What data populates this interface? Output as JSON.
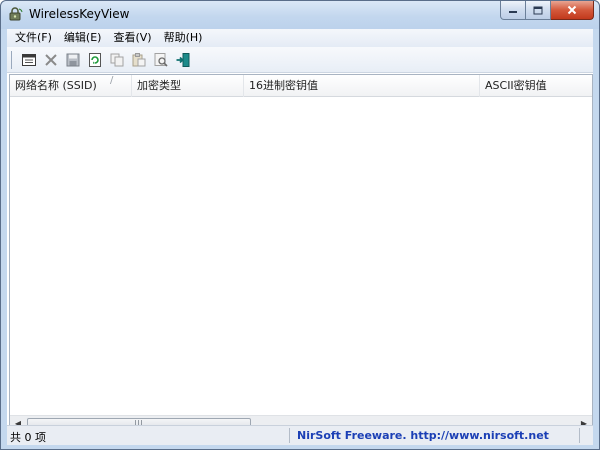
{
  "window": {
    "title": "WirelessKeyView",
    "colors": {
      "title_bg": "#c4d8ee",
      "close_btn": "#c2391c",
      "link_blue": "#1b3fb5"
    }
  },
  "menubar": {
    "items": [
      {
        "label": "文件(F)"
      },
      {
        "label": "编辑(E)"
      },
      {
        "label": "查看(V)"
      },
      {
        "label": "帮助(H)"
      }
    ]
  },
  "toolbar": {
    "buttons": [
      {
        "icon": "properties-icon"
      },
      {
        "icon": "delete-icon"
      },
      {
        "icon": "save-icon"
      },
      {
        "icon": "refresh-icon"
      },
      {
        "icon": "copy-icon"
      },
      {
        "icon": "paste-icon"
      },
      {
        "icon": "find-icon"
      },
      {
        "icon": "exit-icon"
      }
    ]
  },
  "list": {
    "columns": [
      {
        "label": "网络名称 (SSID)"
      },
      {
        "label": "加密类型"
      },
      {
        "label": "16进制密钥值"
      },
      {
        "label": "ASCII密钥值"
      }
    ],
    "sort_glyph": "/",
    "rows": []
  },
  "statusbar": {
    "count_text": "共 0 项",
    "link_text": "NirSoft Freeware.  http://www.nirsoft.net"
  },
  "scrollbar": {
    "grip": "III"
  }
}
